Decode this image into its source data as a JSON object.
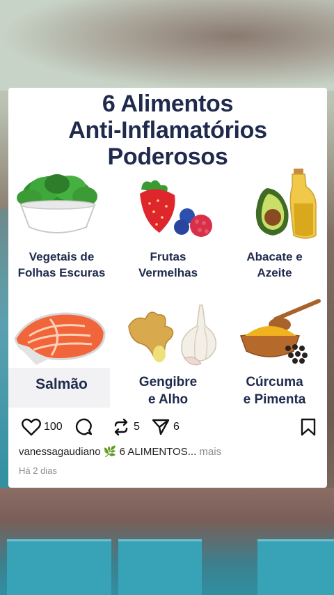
{
  "post": {
    "title_lines": [
      "6 Alimentos",
      "Anti-Inflamatórios",
      "Poderosos"
    ],
    "foods": [
      {
        "label_lines": [
          "Vegetais de",
          "Folhas Escuras"
        ],
        "icon": "leafy-greens-icon"
      },
      {
        "label_lines": [
          "Frutas",
          "Vermelhas"
        ],
        "icon": "red-berries-icon"
      },
      {
        "label_lines": [
          "Abacate e",
          "Azeite"
        ],
        "icon": "avocado-oil-icon"
      },
      {
        "label_lines": [
          "Salmão"
        ],
        "icon": "salmon-icon"
      },
      {
        "label_lines": [
          "Gengibre",
          "e Alho"
        ],
        "icon": "ginger-garlic-icon"
      },
      {
        "label_lines": [
          "Cúrcuma",
          "e Pimenta"
        ],
        "icon": "turmeric-pepper-icon"
      }
    ]
  },
  "actions": {
    "likes": "100",
    "reposts": "5",
    "shares": "6"
  },
  "caption": {
    "username": "vanessagaudiano",
    "emoji": "🌿",
    "text": "6 ALIMENTOS...",
    "more": "mais"
  },
  "time": "Há 2 dias",
  "colors": {
    "title": "#1f2a4d",
    "card": "#ffffff",
    "muted": "#8a8a8a"
  }
}
